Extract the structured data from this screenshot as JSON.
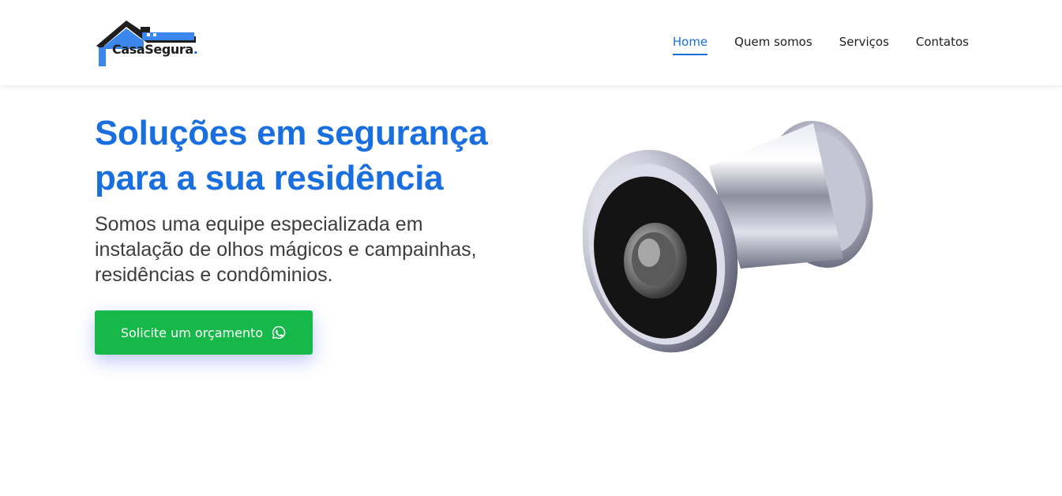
{
  "brand": {
    "name": "CasaSegura",
    "dot": ".",
    "logo_icon": "house-roof-icon",
    "accent_color": "#1a6fe0"
  },
  "nav": {
    "items": [
      {
        "label": "Home",
        "active": true
      },
      {
        "label": "Quem somos",
        "active": false
      },
      {
        "label": "Serviços",
        "active": false
      },
      {
        "label": "Contatos",
        "active": false
      }
    ]
  },
  "hero": {
    "title_line1": "Soluções em segurança",
    "title_line2": "para a sua residência",
    "subtitle_line1": "Somos uma equipe especializada em",
    "subtitle_line2": "instalação de olhos mágicos e campainhas,",
    "subtitle_line3": "residências e condôminios.",
    "cta_label": "Solicite um orçamento",
    "cta_icon": "whatsapp-icon",
    "cta_color": "#16b84a"
  },
  "product_image": {
    "icon": "door-peephole-image"
  }
}
